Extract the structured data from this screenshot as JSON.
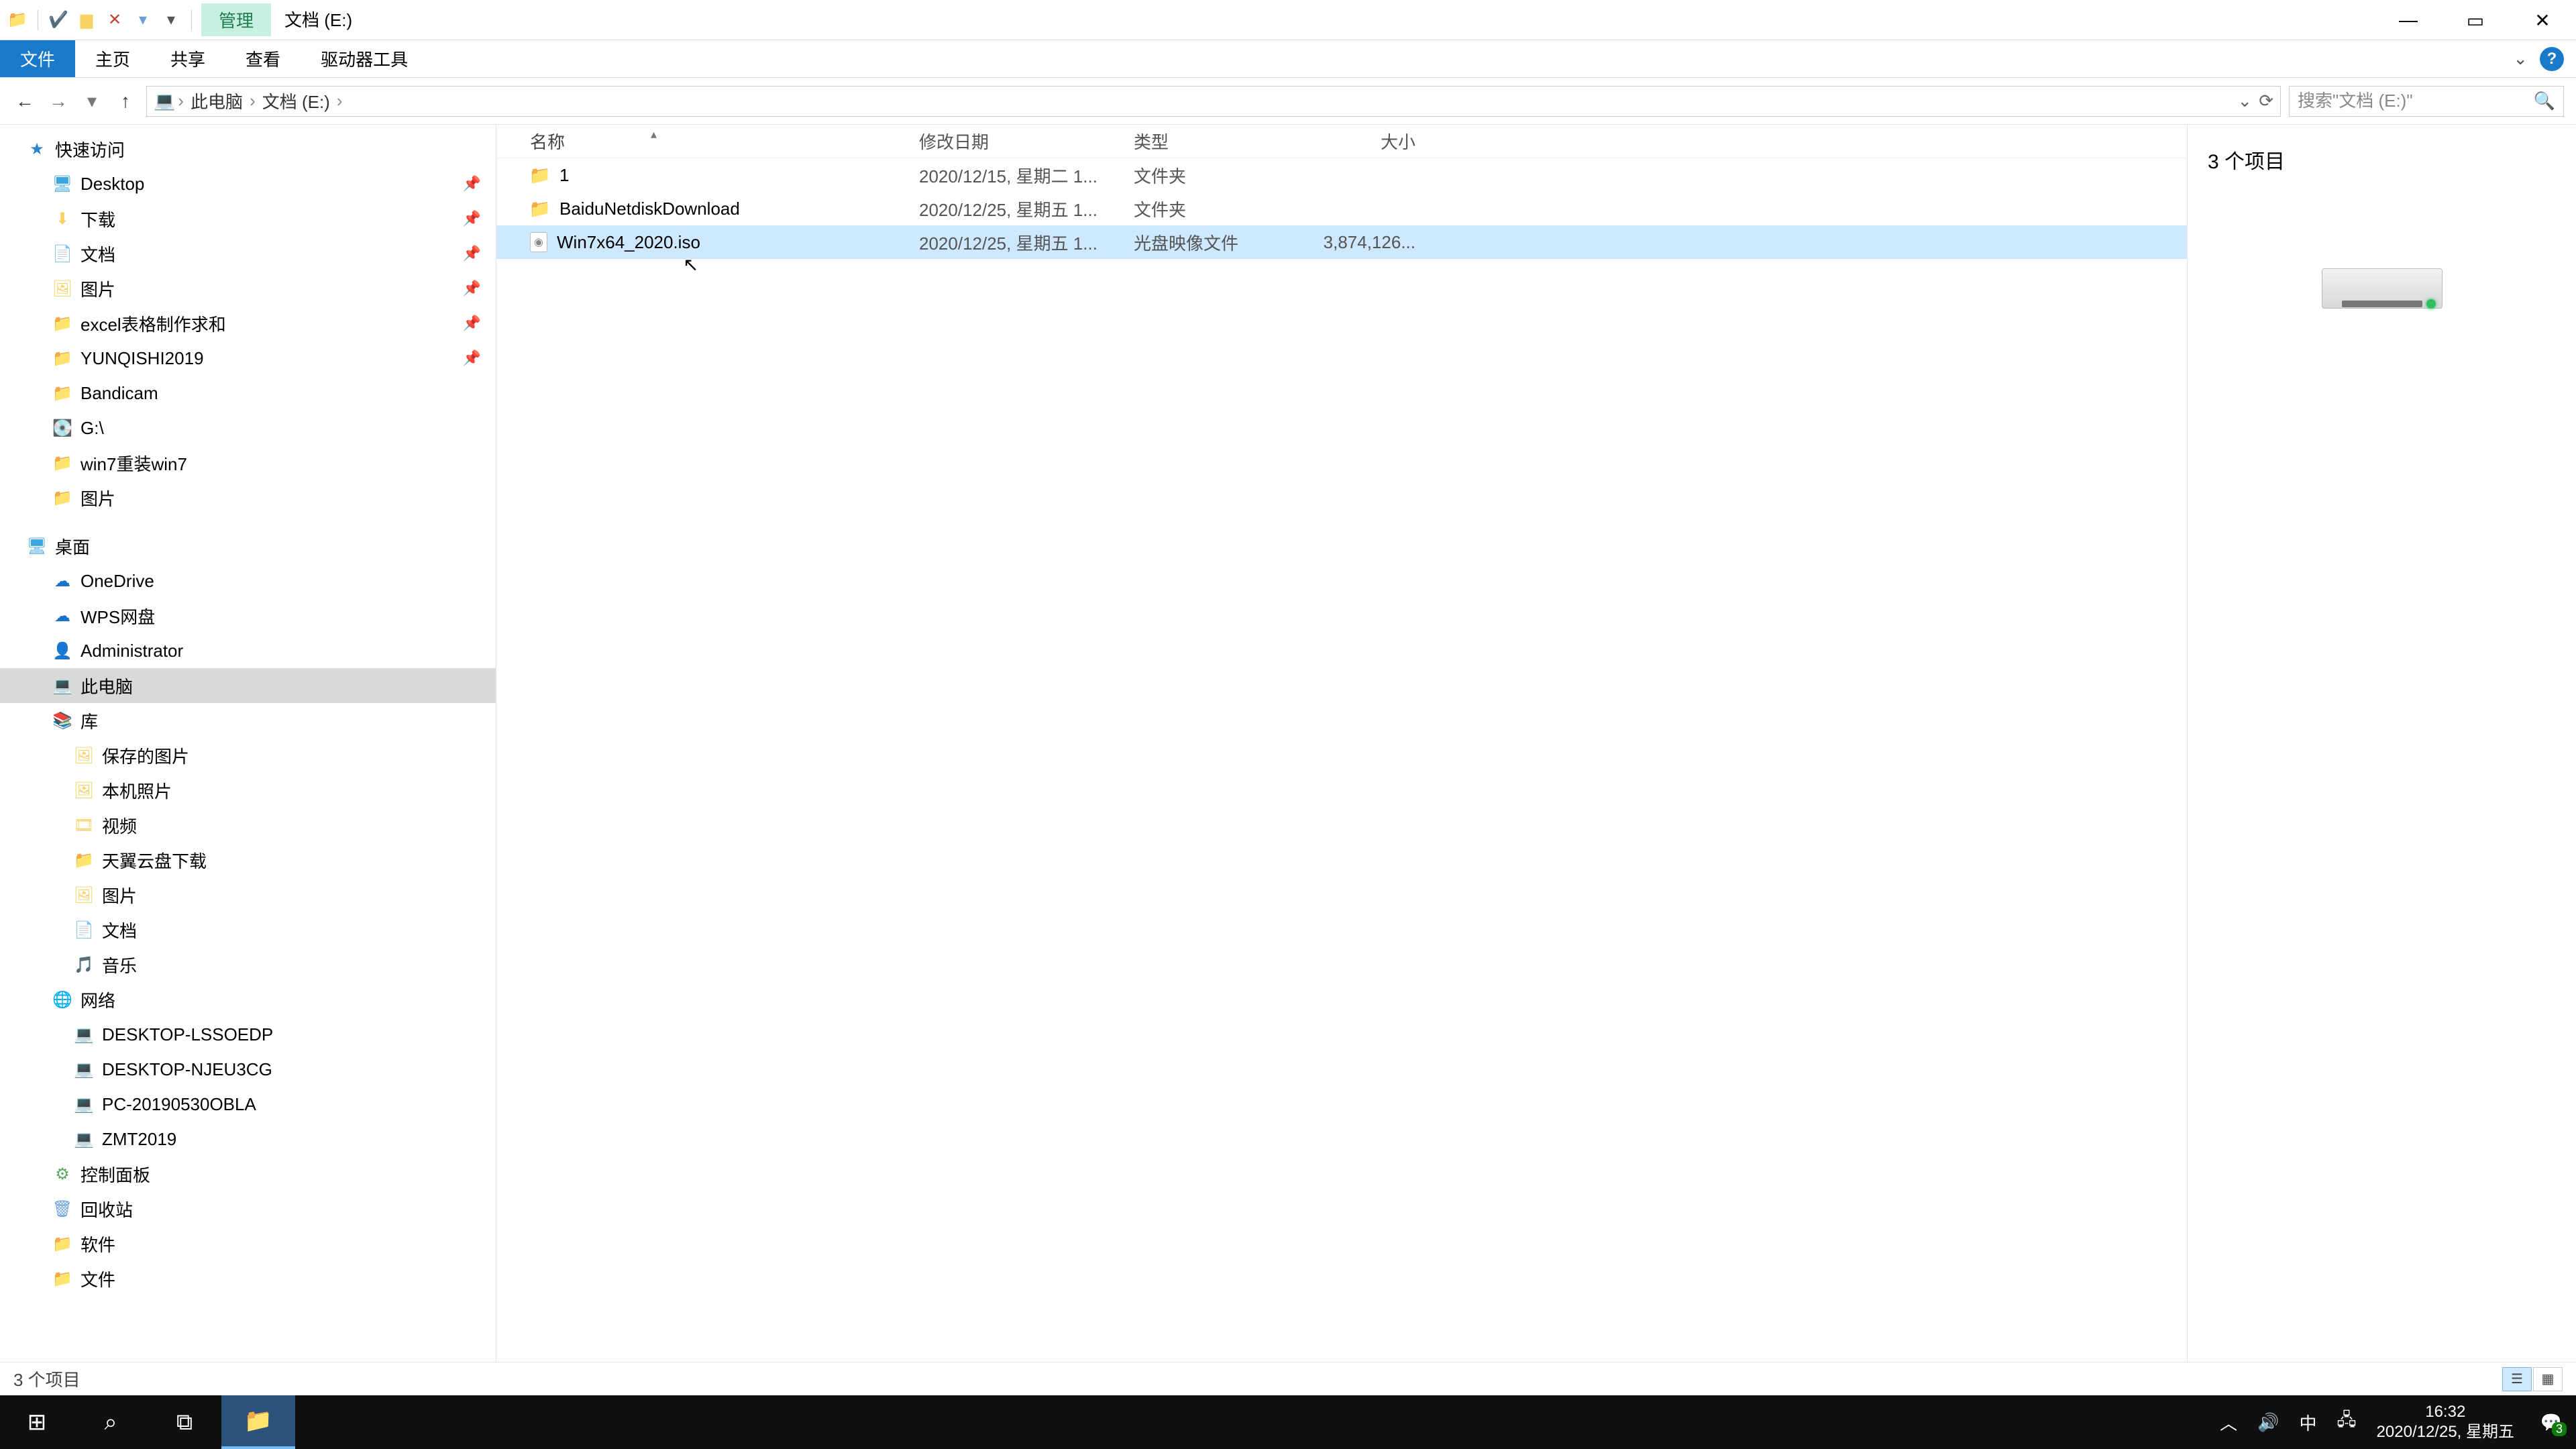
{
  "title_context_tab": "管理",
  "title_window": "文档 (E:)",
  "ribbon": {
    "file": "文件",
    "home": "主页",
    "share": "共享",
    "view": "查看",
    "drive_tools": "驱动器工具"
  },
  "address": {
    "seg_pc": "此电脑",
    "seg_drive": "文档 (E:)"
  },
  "search": {
    "placeholder": "搜索\"文档 (E:)\""
  },
  "tree": {
    "quick_access": "快速访问",
    "desktop": "Desktop",
    "downloads": "下载",
    "documents": "文档",
    "pictures": "图片",
    "excel": "excel表格制作求和",
    "yunqishi": "YUNQISHI2019",
    "bandicam": "Bandicam",
    "gdrive": "G:\\",
    "win7reinstall": "win7重装win7",
    "pictures2": "图片",
    "desktop_cn": "桌面",
    "onedrive": "OneDrive",
    "wps": "WPS网盘",
    "admin": "Administrator",
    "this_pc": "此电脑",
    "libraries": "库",
    "saved_pictures": "保存的图片",
    "camera_roll": "本机照片",
    "videos": "视频",
    "tianyi": "天翼云盘下载",
    "pictures3": "图片",
    "documents2": "文档",
    "music": "音乐",
    "network": "网络",
    "pc1": "DESKTOP-LSSOEDP",
    "pc2": "DESKTOP-NJEU3CG",
    "pc3": "PC-20190530OBLA",
    "pc4": "ZMT2019",
    "control_panel": "控制面板",
    "recycle_bin": "回收站",
    "software": "软件",
    "files": "文件"
  },
  "columns": {
    "name": "名称",
    "date": "修改日期",
    "type": "类型",
    "size": "大小"
  },
  "rows": [
    {
      "name": "1",
      "date": "2020/12/15, 星期二 1...",
      "type": "文件夹",
      "size": "",
      "kind": "folder"
    },
    {
      "name": "BaiduNetdiskDownload",
      "date": "2020/12/25, 星期五 1...",
      "type": "文件夹",
      "size": "",
      "kind": "folder"
    },
    {
      "name": "Win7x64_2020.iso",
      "date": "2020/12/25, 星期五 1...",
      "type": "光盘映像文件",
      "size": "3,874,126...",
      "kind": "iso"
    }
  ],
  "preview": {
    "header": "3 个项目"
  },
  "status": {
    "text": "3 个项目"
  },
  "clock": {
    "time": "16:32",
    "date": "2020/12/25, 星期五"
  },
  "ime": "中",
  "notif_count": "3"
}
